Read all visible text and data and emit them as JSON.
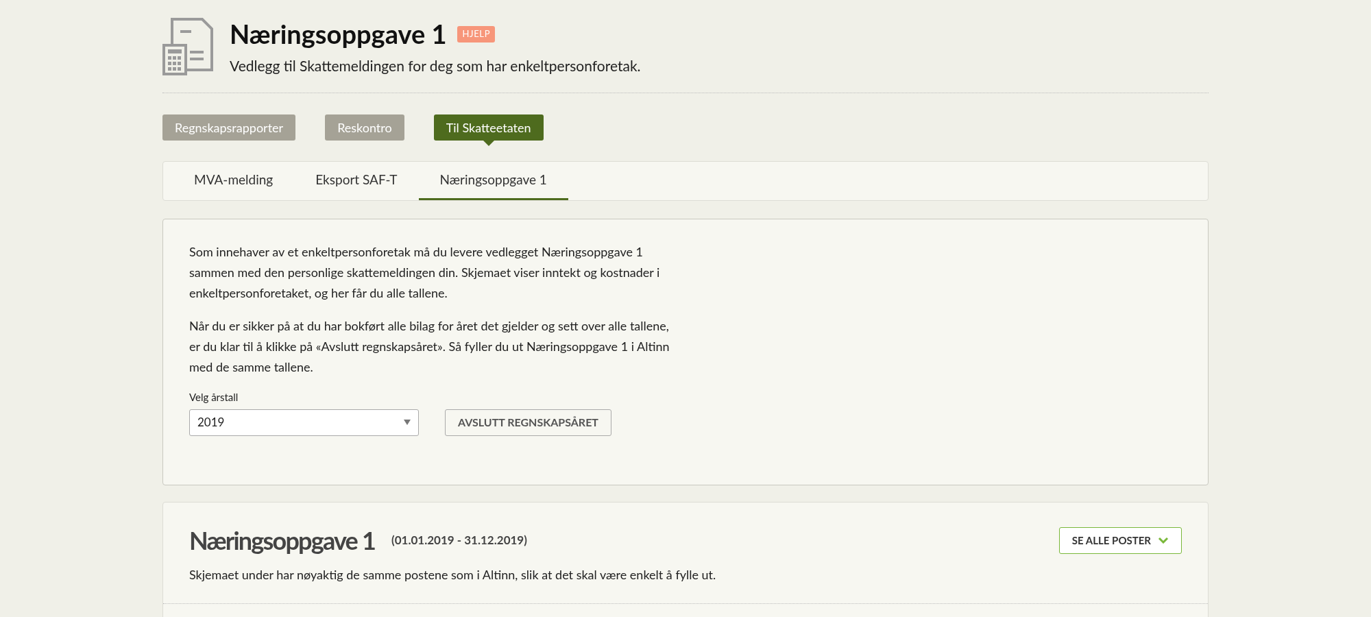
{
  "header": {
    "title": "Næringsoppgave 1",
    "help_badge": "HJELP",
    "subtitle": "Vedlegg til Skattemeldingen for deg som har enkeltpersonforetak."
  },
  "main_nav": [
    {
      "label": "Regnskapsrapporter",
      "selected": false
    },
    {
      "label": "Reskontro",
      "selected": false
    },
    {
      "label": "Til Skatteetaten",
      "selected": true
    }
  ],
  "tabs": [
    {
      "label": "MVA-melding",
      "selected": false
    },
    {
      "label": "Eksport SAF-T",
      "selected": false
    },
    {
      "label": "Næringsoppgave 1",
      "selected": true
    }
  ],
  "info_card": {
    "paragraphs": [
      "Som innehaver av et enkeltpersonforetak må du levere vedlegget Næringsoppgave 1 sammen med den personlige skattemeldingen din. Skjemaet viser inntekt og kostnader i enkeltpersonforetaket, og her får du alle tallene.",
      "Når du er sikker på at du har bokført alle bilag for året det gjelder og sett over alle tallene, er du klar til å klikke på «Avslutt regnskapsåret». Så fyller du ut Næringsoppgave 1 i Altinn med de samme tallene."
    ],
    "year_label": "Velg årstall",
    "year_value": "2019",
    "close_button": "AVSLUTT REGNSKAPSÅRET"
  },
  "form_card": {
    "title": "Næringsoppgave 1",
    "period": "(01.01.2019 - 31.12.2019)",
    "show_all_button": "SE ALLE POSTER",
    "description": "Skjemaet under har nøyaktig de samme postene som i Altinn, slik at det skal være enkelt å fylle ut."
  }
}
